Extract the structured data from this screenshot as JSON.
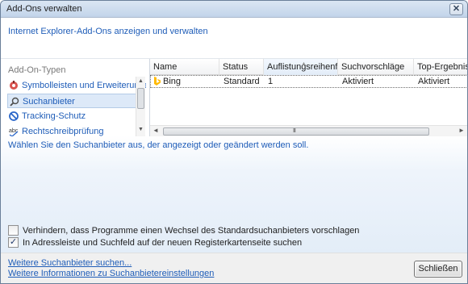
{
  "window": {
    "title": "Add-Ons verwalten",
    "close_glyph": "✕"
  },
  "header": {
    "subtitle": "Internet Explorer-Add-Ons anzeigen und verwalten"
  },
  "categories": {
    "heading": "Add-On-Typen",
    "items": [
      {
        "label": "Symbolleisten und Erweiterungen",
        "icon": "gear-icon"
      },
      {
        "label": "Suchanbieter",
        "icon": "search-icon",
        "selected": true
      },
      {
        "label": "Tracking-Schutz",
        "icon": "block-icon"
      },
      {
        "label": "Rechtschreibprüfung",
        "icon": "spellcheck-icon"
      }
    ],
    "scroll_up": "▲",
    "scroll_down": "▼"
  },
  "table": {
    "columns": [
      "Name",
      "Status",
      "Auflistungsreihenf...",
      "Suchvorschläge",
      "Top-Ergebnis"
    ],
    "sort_glyph": "▲",
    "rows": [
      {
        "name": "Bing",
        "status": "Standard",
        "order": "1",
        "suggestions": "Aktiviert",
        "top_result": "Aktiviert"
      }
    ],
    "scroll_left": "◄",
    "scroll_right": "►",
    "grip": "III"
  },
  "info": "Wählen Sie den Suchanbieter aus, der angezeigt oder geändert werden soll.",
  "options": [
    {
      "label": "Verhindern, dass Programme einen Wechsel des Standardsuchanbieters vorschlagen",
      "checked": false
    },
    {
      "label": "In Adressleiste und Suchfeld auf der neuen Registerkartenseite suchen",
      "checked": true
    }
  ],
  "check_glyph": "✓",
  "footer": {
    "link_more": "Weitere Suchanbieter suchen...",
    "link_info": "Weitere Informationen zu Suchanbietereinstellungen",
    "close_button": "Schließen"
  },
  "colors": {
    "link": "#1f5db8",
    "title_bar": "#c2d4ea",
    "bing": "#ffb900"
  }
}
